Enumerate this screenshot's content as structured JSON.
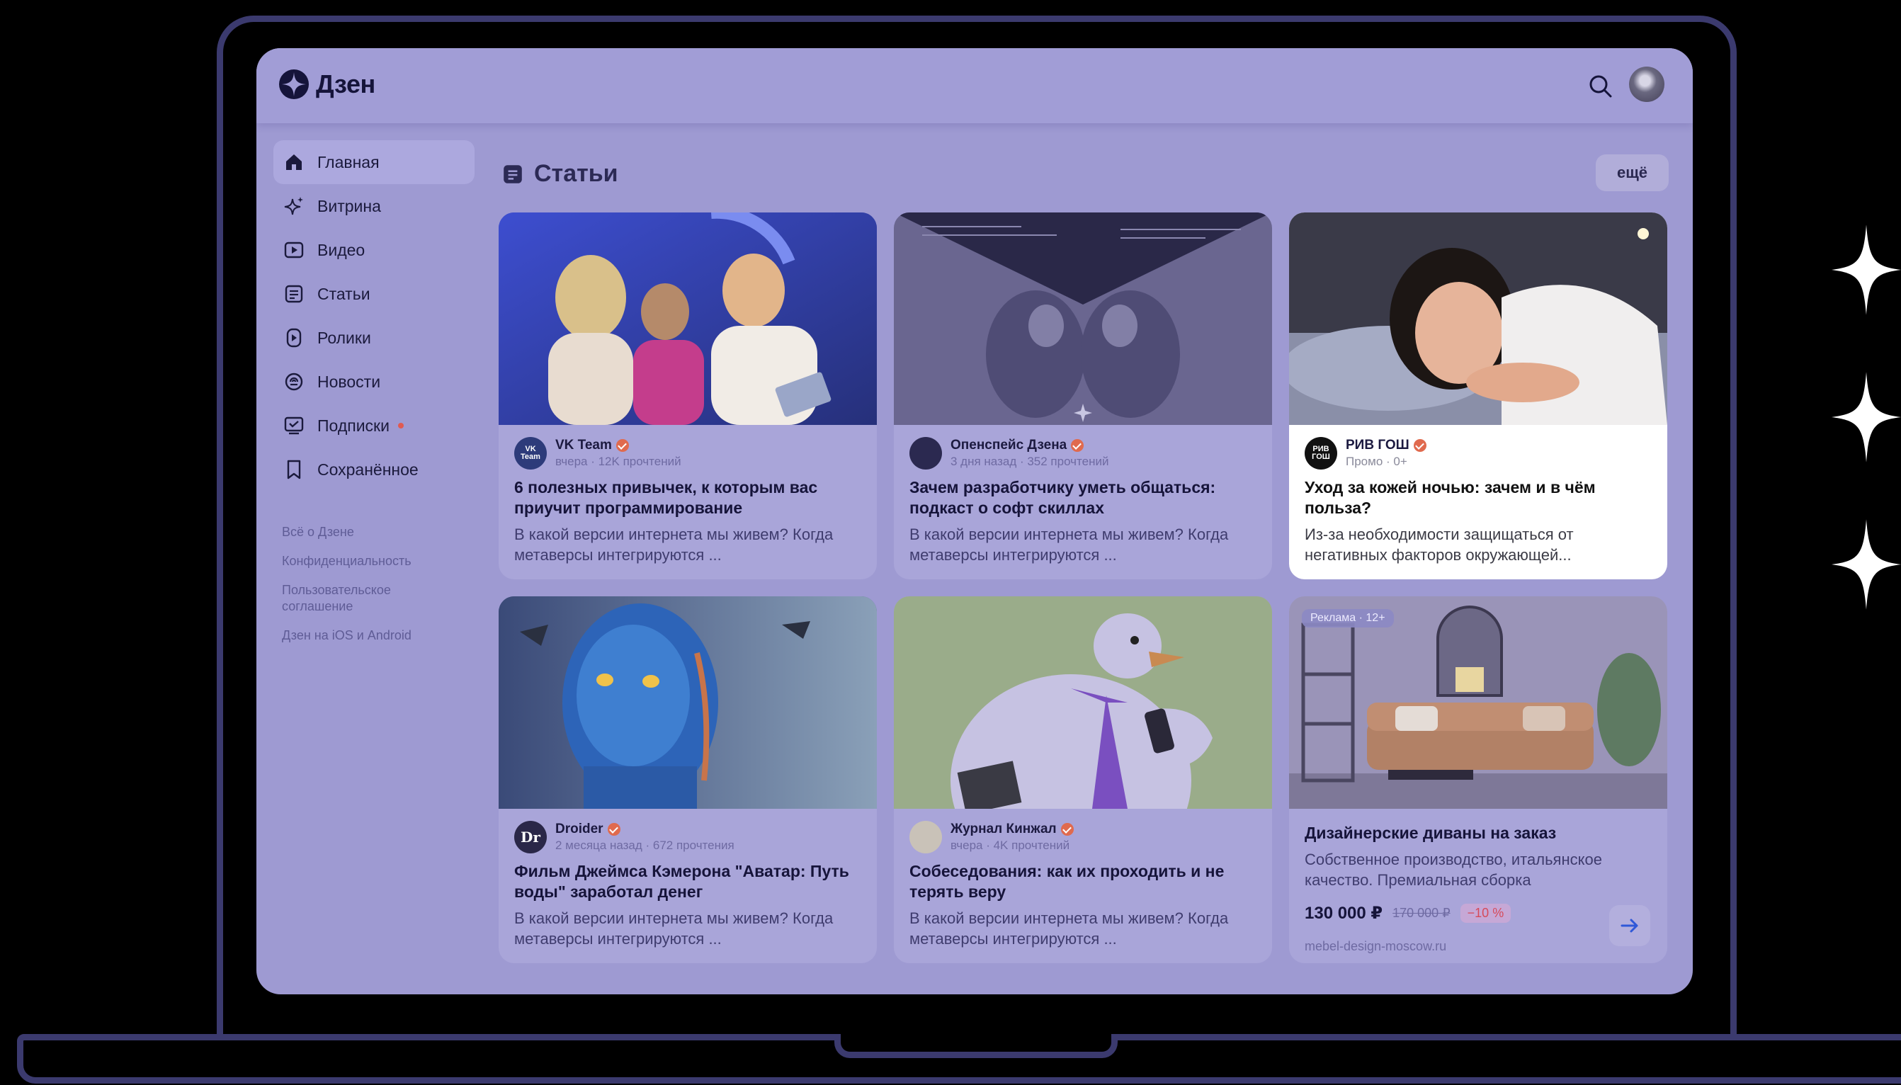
{
  "app": {
    "name": "Дзен"
  },
  "sidebar": {
    "items": [
      {
        "label": "Главная",
        "icon": "home-icon",
        "active": true
      },
      {
        "label": "Витрина",
        "icon": "sparkle-icon"
      },
      {
        "label": "Видео",
        "icon": "video-icon"
      },
      {
        "label": "Статьи",
        "icon": "article-icon"
      },
      {
        "label": "Ролики",
        "icon": "clip-icon"
      },
      {
        "label": "Новости",
        "icon": "news-icon"
      },
      {
        "label": "Подписки",
        "icon": "subscriptions-icon",
        "badge_dot": true
      },
      {
        "label": "Сохранённое",
        "icon": "bookmark-icon"
      }
    ],
    "footer_links": [
      "Всё о Дзене",
      "Конфиденциальность",
      "Пользовательское соглашение",
      "Дзен на iOS и Android"
    ]
  },
  "main": {
    "section_title": "Статьи",
    "more_label": "ещё",
    "cards": [
      {
        "author": "VK Team",
        "avatar_text": "VK Team",
        "avatar_color": "#2d3b7a",
        "meta": "вчера · 12K прочтений",
        "title": "6 полезных привычек, к которым вас приучит программирование",
        "snippet": "В какой версии интернета мы живем? Когда метаверсы интегрируются ..."
      },
      {
        "author": "Опенспейс Дзена",
        "avatar_text": "",
        "avatar_color": "#2b2950",
        "meta": "3 дня назад · 352 прочтений",
        "title": "Зачем разработчику уметь общаться: подкаст о софт скиллах",
        "snippet": "В какой версии интернета мы живем? Когда метаверсы интегрируются ..."
      },
      {
        "author": "РИВ ГОШ",
        "avatar_text": "РИВ ГОШ",
        "avatar_color": "#111111",
        "meta": "Промо · 0+",
        "title": "Уход за кожей ночью: зачем и в чём польза?",
        "snippet": "Из-за необходимости защищаться от негативных факторов окружающей..."
      },
      {
        "author": "Droider",
        "avatar_text": "Dr",
        "avatar_color": "#2a2748",
        "meta": "2 месяца назад · 672 прочтения",
        "title": "Фильм Джеймса Кэмерона \"Аватар: Путь воды\" заработал денег",
        "snippet": "В какой версии интернета мы живем? Когда метаверсы интегрируются ..."
      },
      {
        "author": "Журнал Кинжал",
        "avatar_text": "",
        "avatar_color": "#c9c2b8",
        "meta": "вчера · 4K прочтений",
        "title": "Собеседования: как их проходить и не терять веру",
        "snippet": "В какой версии интернета мы живем? Когда метаверсы интегрируются ..."
      }
    ],
    "ad_card": {
      "badge": "Реклама · 12+",
      "title": "Дизайнерские диваны на заказ",
      "snippet": "Собственное производство, итальянское качество. Премиальная сборка",
      "price": "130 000 ₽",
      "old_price": "170 000 ₽",
      "discount": "−10 %",
      "domain": "mebel-design-moscow.ru"
    }
  },
  "colors": {
    "screen_overlay": "#9e9ad2",
    "accent_orange": "#e06a4e",
    "frame": "#3b3a6e"
  }
}
